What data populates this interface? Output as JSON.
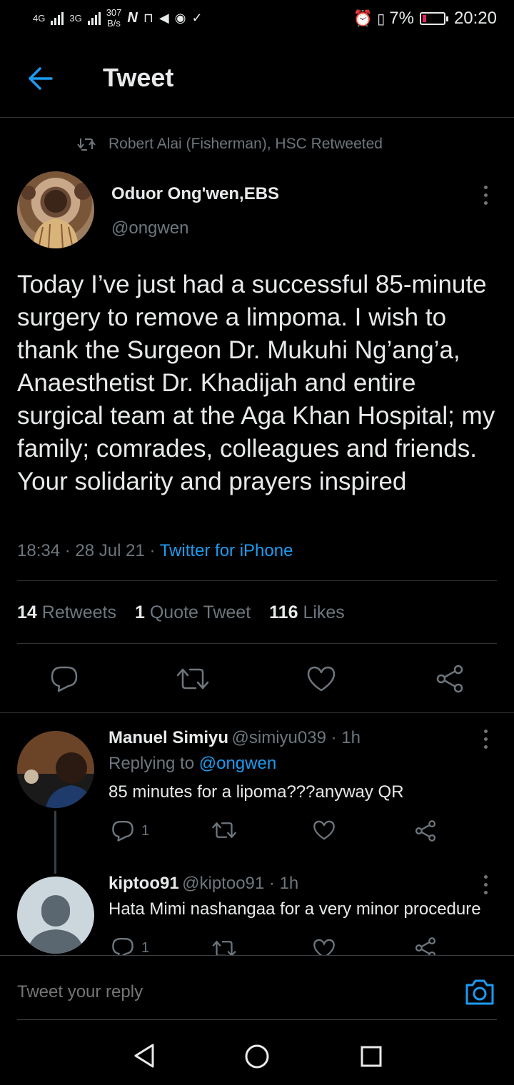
{
  "status_bar": {
    "network1": "4G",
    "network2": "3G",
    "speed_value": "307",
    "speed_unit": "B/s",
    "battery": "7%",
    "battery_level": 0.07,
    "time": "20:20"
  },
  "header": {
    "title": "Tweet"
  },
  "retweet_context": {
    "text": "Robert Alai (Fisherman), HSC Retweeted"
  },
  "tweet": {
    "author_name": "Oduor Ong'wen,EBS",
    "author_handle": "@ongwen",
    "text": "Today I’ve just had a successful 85-minute surgery to remove a limpoma. I wish to thank the Surgeon Dr. Mukuhi Ng’ang’a, Anaesthetist Dr. Khadijah and entire surgical team at the Aga Khan Hospital; my family; comrades, colleagues and friends. Your solidarity and prayers inspired",
    "timestamp": "18:34 · 28 Jul 21 ·",
    "source": "Twitter for iPhone",
    "stats": {
      "retweets_count": "14",
      "retweets_label": "Retweets",
      "quotes_count": "1",
      "quotes_label": "Quote Tweet",
      "likes_count": "116",
      "likes_label": "Likes"
    }
  },
  "replies": [
    {
      "name": "Manuel Simiyu",
      "meta": "@simiyu039 · 1h",
      "replying_prefix": "Replying to",
      "replying_handle": "@ongwen",
      "text": "85 minutes for a lipoma???anyway QR",
      "reply_count": "1"
    },
    {
      "name": "kiptoo91",
      "meta": "@kiptoo91 · 1h",
      "text": "Hata Mimi nashangaa for a very minor procedure",
      "reply_count": "1"
    }
  ],
  "compose": {
    "placeholder": "Tweet your reply"
  },
  "icons": {
    "accent": "#1d9bf0",
    "muted": "#6e767d"
  }
}
